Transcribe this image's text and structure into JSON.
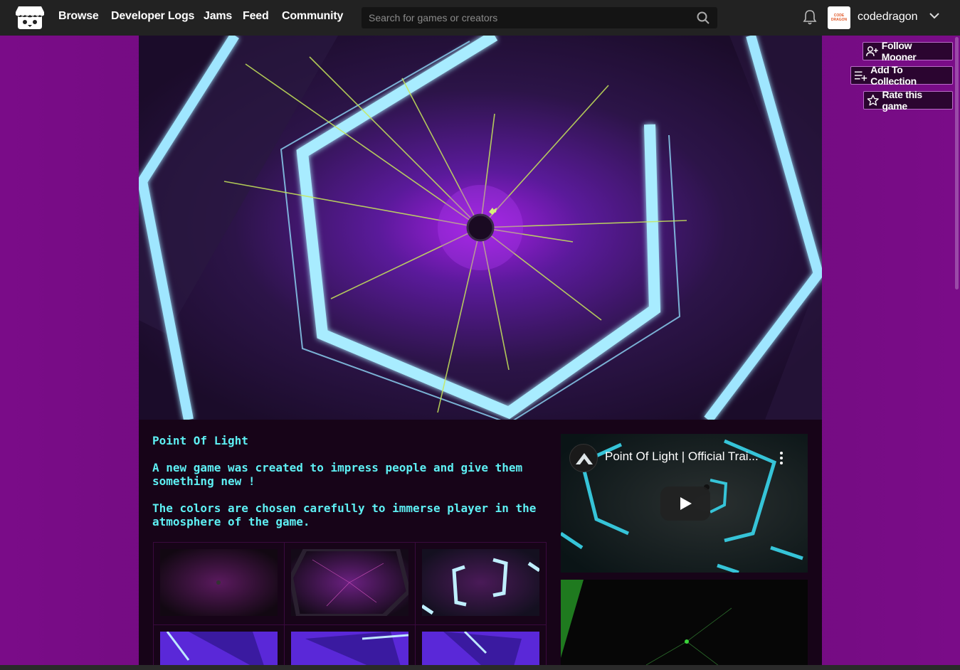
{
  "nav": {
    "logo_icon": "itchio-logo-icon",
    "links": [
      "Browse",
      "Developer Logs",
      "Jams",
      "Feed",
      "Community"
    ],
    "search_placeholder": "Search for games or creators",
    "username": "codedragon",
    "avatar_text": [
      "CODE",
      "DRAGON"
    ]
  },
  "actions": {
    "follow": "Follow Mooner",
    "collection": "Add To Collection",
    "rate": "Rate this game"
  },
  "game": {
    "title": "Point Of Light",
    "paragraphs": [
      "A new game was created to impress people and give them something new !",
      "The colors are chosen carefully to immerse player in the atmosphere of the game."
    ]
  },
  "video": {
    "title": "Point Of Light | Official Trai..."
  },
  "colors": {
    "page_bg": "#6d0a7c",
    "main_bg": "#170418",
    "text_accent": "#5ef0f4",
    "nav_bg": "#222222"
  }
}
